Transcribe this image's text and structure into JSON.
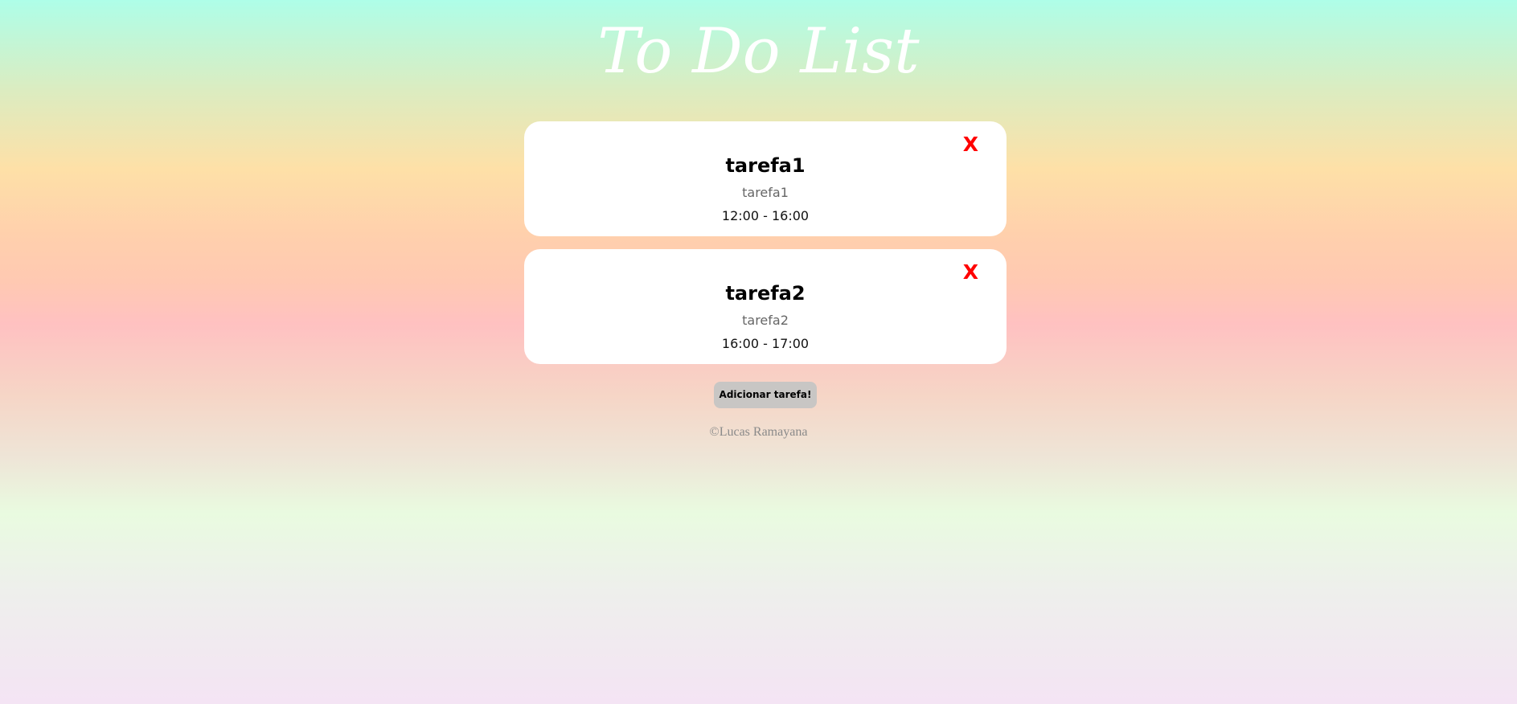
{
  "header": {
    "title": "To Do List"
  },
  "tasks": [
    {
      "title": "tarefa1",
      "description": "tarefa1",
      "time": "12:00 - 16:00",
      "delete_label": "X"
    },
    {
      "title": "tarefa2",
      "description": "tarefa2",
      "time": "16:00 - 17:00",
      "delete_label": "X"
    }
  ],
  "actions": {
    "add_label": "Adicionar tarefa!"
  },
  "footer": {
    "credit": "©Lucas Ramayana"
  },
  "colors": {
    "delete": "#ff0000",
    "card_background": "#ffffff",
    "button_background": "#c8c6c4"
  }
}
